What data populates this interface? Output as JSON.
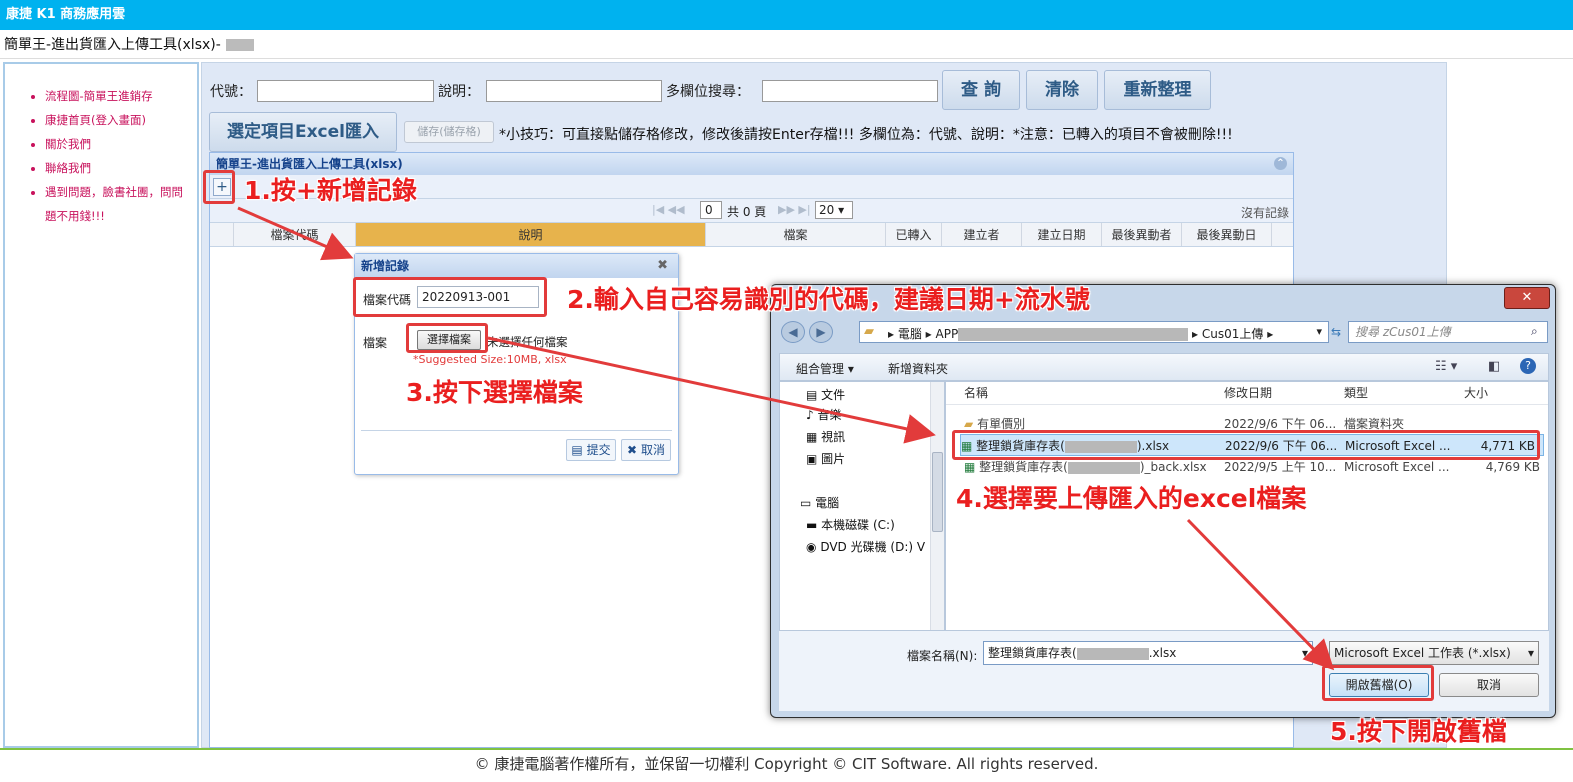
{
  "topbar": {
    "title": "康捷 K1 商務應用雲"
  },
  "subtitle": "簡單王-進出貨匯入上傳工具(xlsx)-",
  "sidebar": {
    "items": [
      "流程圖-簡單王進銷存",
      "康捷首頁(登入畫面)",
      "關於我們",
      "聯絡我們",
      "遇到問題，臉書社團，問問",
      "題不用錢!!!"
    ]
  },
  "search": {
    "code_label": "代號：",
    "desc_label": "說明：",
    "multi_label": "多欄位搜尋：",
    "query_btn": "查 詢",
    "clear_btn": "清除",
    "reset_btn": "重新整理"
  },
  "toolbar": {
    "import_btn": "選定項目Excel匯入",
    "save_btn": "儲存(儲存格)",
    "tip": "*小技巧：可直接點儲存格修改，修改後請按Enter存檔!!! 多欄位為：代號、說明：*注意：已轉入的項目不會被刪除!!!"
  },
  "grid": {
    "title": "簡單王-進出貨匯入上傳工具(xlsx)",
    "add": "+",
    "page_value": "0",
    "page_total": "共 0 頁",
    "page_size": "20",
    "no_records": "沒有記錄",
    "columns": [
      "檔案代碼",
      "說明",
      "檔案",
      "已轉入",
      "建立者",
      "建立日期",
      "最後異動者",
      "最後異動日"
    ]
  },
  "dialog": {
    "title": "新增記錄",
    "code_label": "檔案代碼",
    "code_value": "20220913-001",
    "file_label": "檔案",
    "choose_btn": "選擇檔案",
    "no_file": "未選擇任何檔案",
    "hint": "*Suggested Size:10MB, xlsx",
    "submit": "提交",
    "cancel": "取消"
  },
  "filedlg": {
    "path_pc": "電腦",
    "path_app": "APP",
    "path_folder": "Cus01上傳",
    "search_placeholder": "搜尋 zCus01上傳",
    "organize": "組合管理",
    "new_folder": "新增資料夾",
    "nav": [
      "文件",
      "音樂",
      "視訊",
      "圖片",
      "電腦",
      "本機磁碟 (C:)",
      "DVD 光碟機 (D:) V"
    ],
    "cols": [
      "名稱",
      "修改日期",
      "類型",
      "大小"
    ],
    "files": [
      {
        "name": "有單價別",
        "date": "2022/9/6 下午 06...",
        "type": "檔案資料夾",
        "size": ""
      },
      {
        "name": "整理鎖貨庫存表(",
        "suffix": ").xlsx",
        "date": "2022/9/6 下午 06...",
        "type": "Microsoft Excel ...",
        "size": "4,771 KB"
      },
      {
        "name": "整理鎖貨庫存表(",
        "suffix": ")_back.xlsx",
        "date": "2022/9/5 上午 10...",
        "type": "Microsoft Excel ...",
        "size": "4,769 KB"
      }
    ],
    "filename_label": "檔案名稱(N):",
    "filename_value": "整理鎖貨庫存表(",
    "filename_suffix": ".xlsx",
    "filetype": "Microsoft Excel 工作表 (*.xlsx)",
    "open_btn": "開啟舊檔(O)",
    "cancel_btn": "取消"
  },
  "annotations": [
    "1.按+新增記錄",
    "2.輸入自己容易識別的代碼，建議日期+流水號",
    "3.按下選擇檔案",
    "4.選擇要上傳匯入的excel檔案",
    "5.按下開啟舊檔"
  ],
  "footer": "© 康捷電腦著作權所有，並保留一切權利 Copyright © CIT Software. All rights reserved.",
  "colors": {
    "topbar": "#00b2ef",
    "annotation": "#ea1f1f",
    "link": "#c8125c",
    "footer_border": "#7fc241"
  }
}
